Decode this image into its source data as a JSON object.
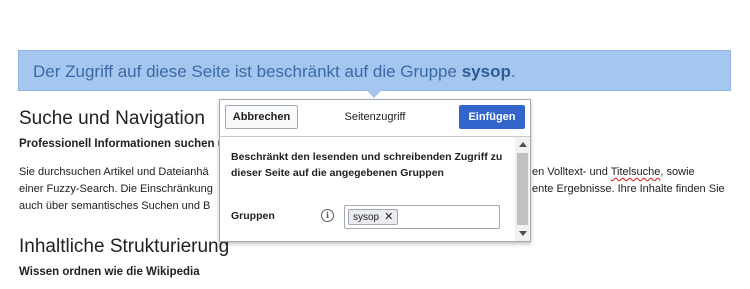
{
  "notice": {
    "text": "Der Zugriff auf diese Seite ist beschränkt auf die Gruppe",
    "group": "sysop",
    "end": "."
  },
  "section1": {
    "heading": "Suche und Navigation",
    "subheading": "Professionell Informationen suchen u",
    "para_left": [
      "Sie durchsuchen Artikel und Dateianhä",
      "einer Fuzzy-Search. Die Einschränkung",
      "auch über semantisches Suchen und B"
    ],
    "para_right_1a": "en Volltext- und ",
    "para_right_1b": "Titelsuche",
    "para_right_1c": ", sowie",
    "para_right_2": "ente Ergebnisse. Ihre Inhalte finden Sie"
  },
  "section2": {
    "heading": "Inhaltliche Strukturierung",
    "subheading": "Wissen ordnen wie die Wikipedia"
  },
  "dialog": {
    "cancel_label": "Abbrechen",
    "title": "Seitenzugriff",
    "insert_label": "Einfügen",
    "description": "Beschränkt den lesenden und schreibenden Zugriff zu dieser Seite auf die angegebenen Gruppen",
    "groups_label": "Gruppen",
    "info_glyph": "i",
    "tag_value": "sysop",
    "tag_remove_glyph": "✕"
  },
  "colors": {
    "notice_bg": "#a5c6ef",
    "primary_button": "#3366cc"
  }
}
